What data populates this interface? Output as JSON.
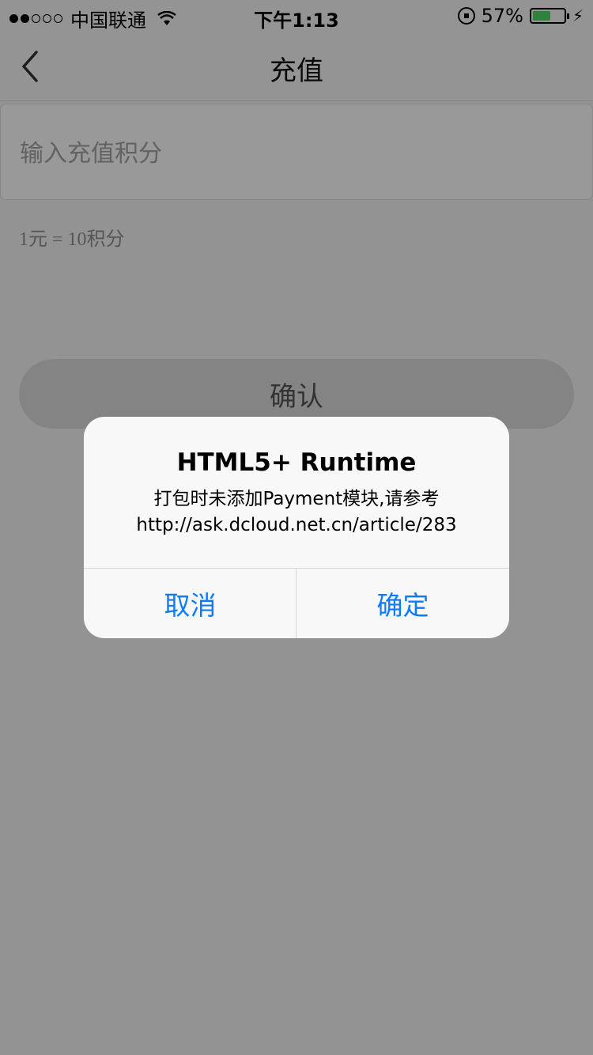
{
  "status_bar": {
    "carrier": "中国联通",
    "time": "下午1:13",
    "battery": "57%",
    "battery_level": 0.57
  },
  "nav": {
    "title": "充值"
  },
  "form": {
    "points_placeholder": "输入充值积分",
    "rate_text": "1元 = 10积分",
    "confirm_label": "确认"
  },
  "alert": {
    "title": "HTML5+ Runtime",
    "message_line1": "打包时未添加Payment模块,请参考",
    "message_line2": "http://ask.dcloud.net.cn/article/283",
    "cancel_label": "取消",
    "ok_label": "确定"
  },
  "colors": {
    "accent": "#0a7bff",
    "battery_fill": "#4cd964"
  }
}
